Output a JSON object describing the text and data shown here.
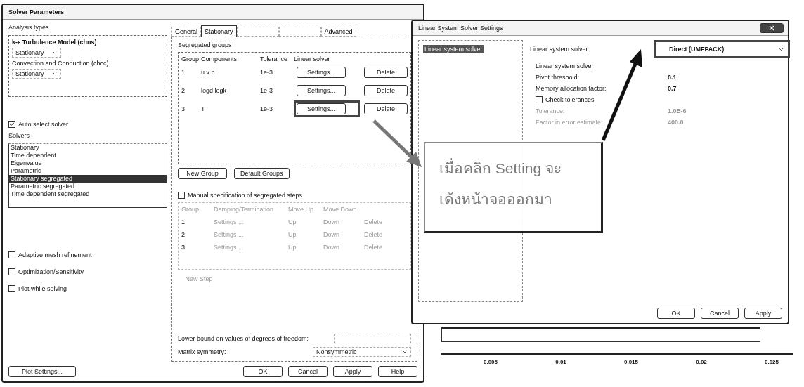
{
  "solver_parameters": {
    "title": "Solver Parameters",
    "analysis_types": {
      "label": "Analysis types",
      "items": [
        {
          "name": "k-ε Turbulence Model (chns)",
          "study": "Stationary"
        },
        {
          "name": "Convection and Conduction (chcc)",
          "study": "Stationary"
        }
      ]
    },
    "auto_select_solver": {
      "label": "Auto select solver",
      "checked": true
    },
    "solvers": {
      "label": "Solvers",
      "items": [
        {
          "label": "Stationary",
          "selected": false
        },
        {
          "label": "Time dependent",
          "selected": false
        },
        {
          "label": "Eigenvalue",
          "selected": false
        },
        {
          "label": "Parametric",
          "selected": false
        },
        {
          "label": "Stationary segregated",
          "selected": true
        },
        {
          "label": "Parametric segregated",
          "selected": false
        },
        {
          "label": "Time dependent segregated",
          "selected": false
        }
      ]
    },
    "options": [
      {
        "label": "Adaptive mesh refinement",
        "checked": false
      },
      {
        "label": "Optimization/Sensitivity",
        "checked": false
      },
      {
        "label": "Plot while solving",
        "checked": false
      }
    ],
    "plot_settings_button": "Plot Settings...",
    "tabs": [
      {
        "label": "General",
        "selected": false
      },
      {
        "label": "Stationary",
        "selected": true
      },
      {
        "selected": false
      },
      {
        "selected": false
      },
      {
        "label": "Advanced",
        "selected": false
      }
    ],
    "segregated_groups": {
      "label": "Segregated groups",
      "columns": [
        "Group",
        "Components",
        "Tolerance",
        "Linear solver"
      ],
      "rows": [
        {
          "group": "1",
          "components": "u v p",
          "tolerance": "1e-3",
          "settings": "Settings...",
          "delete": "Delete",
          "highlighted": false
        },
        {
          "group": "2",
          "components": "logd logk",
          "tolerance": "1e-3",
          "settings": "Settings...",
          "delete": "Delete",
          "highlighted": false
        },
        {
          "group": "3",
          "components": "T",
          "tolerance": "1e-3",
          "settings": "Settings...",
          "delete": "Delete",
          "highlighted": true
        }
      ]
    },
    "group_buttons": [
      "New Group",
      "Default Groups"
    ],
    "manual_steps": {
      "label": "Manual specification of segregated steps",
      "checked": false,
      "disabled": true,
      "columns": [
        "Group",
        "Damping/Termination",
        "Move Up",
        "Move Down"
      ],
      "rows": [
        {
          "group": "1",
          "settings": "Settings ...",
          "up": "Up",
          "down": "Down",
          "delete": "Delete"
        },
        {
          "group": "2",
          "settings": "Settings ...",
          "up": "Up",
          "down": "Down",
          "delete": "Delete"
        },
        {
          "group": "3",
          "settings": "Settings ...",
          "up": "Up",
          "down": "Down",
          "delete": "Delete"
        }
      ],
      "new_step": "New Step"
    },
    "lower_bound": {
      "label": "Lower bound on values of degrees of freedom:"
    },
    "matrix_symmetry": {
      "label": "Matrix symmetry:",
      "value": "Nonsymmetric"
    },
    "buttons": [
      "OK",
      "Cancel",
      "Apply",
      "Help"
    ]
  },
  "linear_solver_settings": {
    "title": "Linear System Solver Settings",
    "tree": [
      {
        "label": "Linear system solver",
        "selected": true
      }
    ],
    "solver_label": "Linear system solver:",
    "solver_value": "Direct (UMFPACK)",
    "highlighted": true,
    "section": "Linear system solver",
    "fields": [
      {
        "kind": "value",
        "label": "Pivot threshold:",
        "value": "0.1",
        "disabled": false
      },
      {
        "kind": "value",
        "label": "Memory allocation factor:",
        "value": "0.7",
        "disabled": false
      },
      {
        "kind": "checkbox",
        "label": "Check tolerances",
        "checked": false
      },
      {
        "kind": "value",
        "label": "Tolerance:",
        "value": "1.0E-6",
        "disabled": true
      },
      {
        "kind": "value",
        "label": "Factor in error estimate:",
        "value": "400.0",
        "disabled": true
      }
    ],
    "buttons": [
      "OK",
      "Cancel",
      "Apply"
    ]
  },
  "callout": {
    "lines": [
      "เมื่อคลิก Setting จะ",
      "เด้งหน้าจอออกมา"
    ]
  },
  "background_axis": {
    "ticks": [
      "0.005",
      "0.01",
      "0.015",
      "0.02",
      "0.025"
    ]
  }
}
